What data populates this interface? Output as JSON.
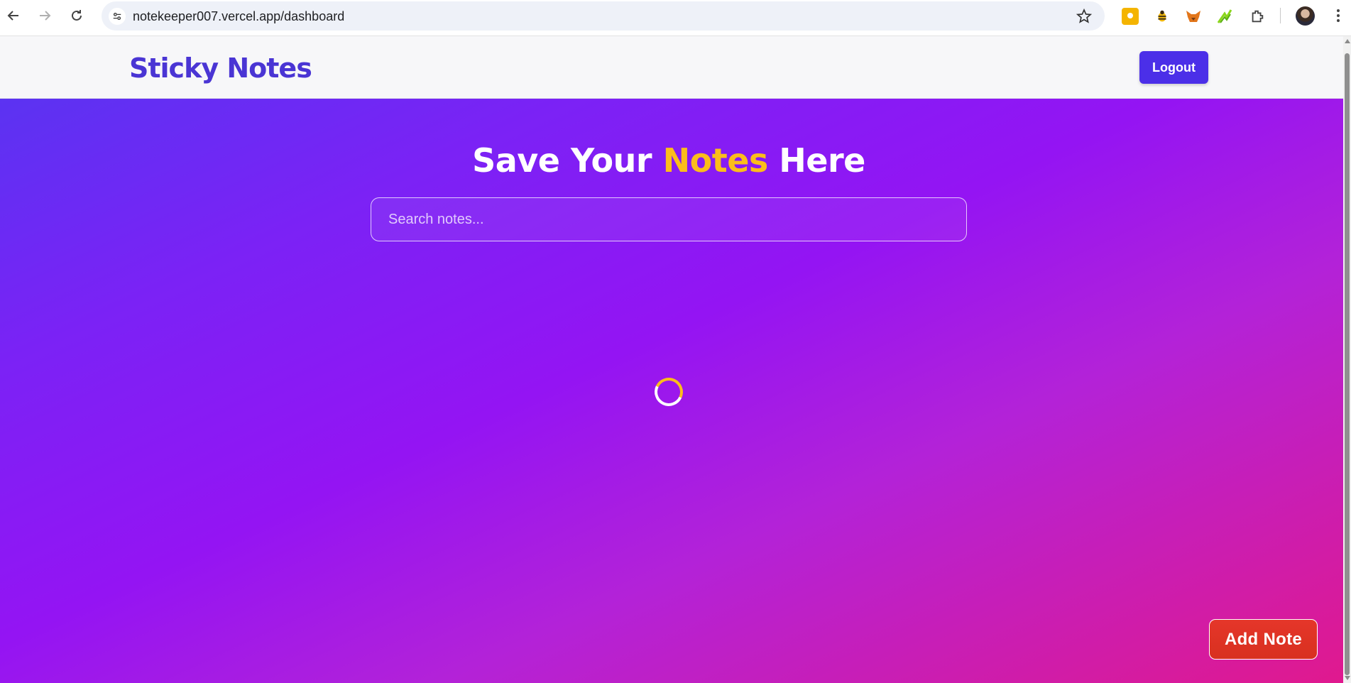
{
  "browser": {
    "url": "notekeeper007.vercel.app/dashboard",
    "icons": [
      "back-icon",
      "forward-icon",
      "reload-icon",
      "site-info-icon",
      "bookmark-star-icon",
      "extensions-icon",
      "menu-icon"
    ],
    "extensions": [
      "keep-extension-icon",
      "bee-extension-icon",
      "fox-extension-icon",
      "chart-extension-icon"
    ]
  },
  "header": {
    "brand": "Sticky Notes",
    "logout_label": "Logout"
  },
  "main": {
    "hero_prefix": "Save Your ",
    "hero_accent": "Notes",
    "hero_suffix": " Here",
    "search_placeholder": "Search notes...",
    "add_note_label": "Add Note"
  },
  "colors": {
    "brand": "#4a35d4",
    "accent": "#fbbd1b",
    "button": "#4b2fe8",
    "add_note": "#e5362a",
    "gradient_start": "#5b33f2",
    "gradient_end": "#e0198e"
  }
}
